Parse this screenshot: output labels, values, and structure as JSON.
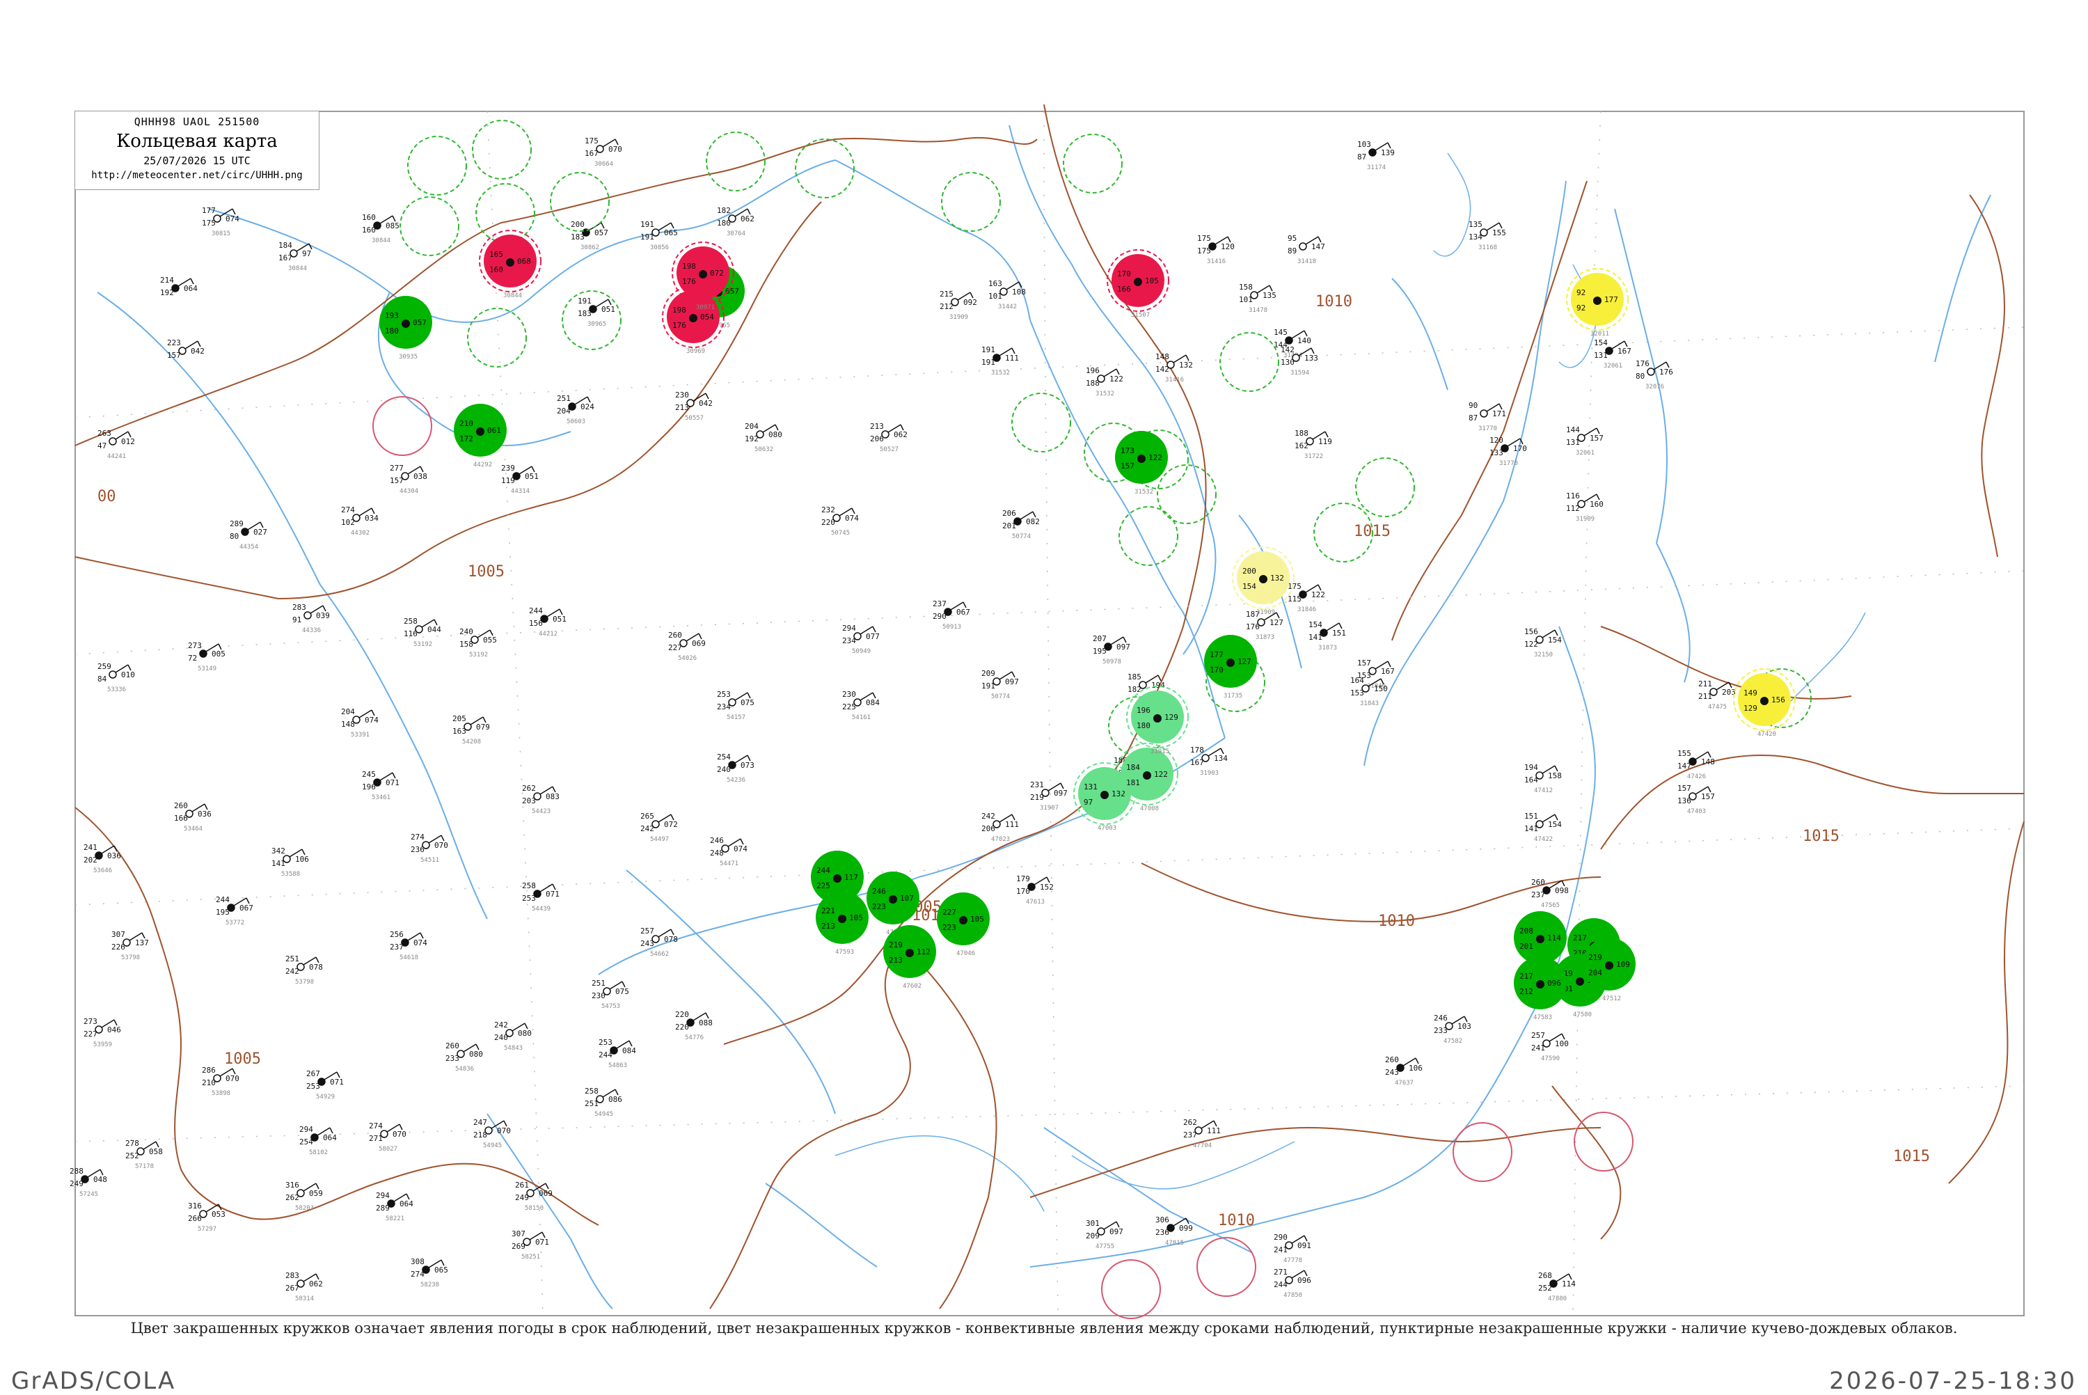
{
  "header": {
    "bulletin": "QHHH98  UAOL  251500",
    "title": "Кольцевая карта",
    "datetime": "25/07/2026 15 UTC",
    "url": "http://meteocenter.net/circ/UHHH.png"
  },
  "caption": "Цвет закрашенных кружков означает явления погоды в срок наблюдений, цвет незакрашенных кружков - конвективные явления между сроками наблюдений, пунктирные незакрашенные кружки - наличие кучево-дождевых облаков.",
  "footer": {
    "left": "GrADS/COLA",
    "right": "2026-07-25-18:30"
  },
  "colors": {
    "frame": "#999999",
    "isobar": "#a0522d",
    "river": "#6aaee8",
    "cb_ring": "#2eb82e",
    "rain": "#00b400",
    "shower": "#66e08a",
    "thunder": "#e8194a",
    "fog": "#f7ef3a",
    "fog_light": "#f7f39a"
  },
  "isobars": [
    {
      "label": "1005"
    },
    {
      "label": "1010"
    },
    {
      "label": "1015"
    }
  ],
  "stations": [
    {
      "t": "214",
      "p": "064",
      "td": "192",
      "id": ""
    },
    {
      "t": "177",
      "p": "074",
      "td": "175",
      "id": "30815"
    },
    {
      "t": "184",
      "p": "97",
      "td": "167",
      "id": "30844"
    },
    {
      "t": "160",
      "p": "085",
      "td": "160",
      "id": "30844"
    },
    {
      "t": "223",
      "p": "042",
      "td": "157",
      "id": ""
    },
    {
      "t": "263",
      "p": "012",
      "td": "47",
      "id": "44241"
    },
    {
      "t": "289",
      "p": "027",
      "td": "80",
      "id": "44354"
    },
    {
      "t": "274",
      "p": "034",
      "td": "102",
      "id": "44302"
    },
    {
      "t": "277",
      "p": "038",
      "td": "157",
      "id": "44304"
    },
    {
      "t": "239",
      "p": "051",
      "td": "119",
      "id": "44314"
    },
    {
      "t": "283",
      "p": "039",
      "td": "91",
      "id": "44336"
    },
    {
      "t": "259",
      "p": "010",
      "td": "84",
      "id": "53336"
    },
    {
      "t": "273",
      "p": "005",
      "td": "72",
      "id": "53149"
    },
    {
      "t": "258",
      "p": "044",
      "td": "116",
      "id": "53192"
    },
    {
      "t": "240",
      "p": "055",
      "td": "158",
      "id": "53192"
    },
    {
      "t": "244",
      "p": "051",
      "td": "156",
      "id": "44212"
    },
    {
      "t": "260",
      "p": "069",
      "td": "227",
      "id": "54026"
    },
    {
      "t": "294",
      "p": "077",
      "td": "234",
      "id": "50949"
    },
    {
      "t": "237",
      "p": "067",
      "td": "290",
      "id": "50913"
    },
    {
      "t": "232",
      "p": "074",
      "td": "220",
      "id": "50745"
    },
    {
      "t": "230",
      "p": "042",
      "td": "213",
      "id": "50557"
    },
    {
      "t": "251",
      "p": "024",
      "td": "204",
      "id": "50603"
    },
    {
      "t": "204",
      "p": "080",
      "td": "192",
      "id": "50632"
    },
    {
      "t": "213",
      "p": "062",
      "td": "206",
      "id": "50527"
    },
    {
      "t": "206",
      "p": "082",
      "td": "201",
      "id": "50774"
    },
    {
      "t": "230",
      "p": "084",
      "td": "225",
      "id": "54161"
    },
    {
      "t": "253",
      "p": "075",
      "td": "234",
      "id": "54157"
    },
    {
      "t": "254",
      "p": "073",
      "td": "240",
      "id": "54236"
    },
    {
      "t": "204",
      "p": "074",
      "td": "148",
      "id": "53391"
    },
    {
      "t": "205",
      "p": "079",
      "td": "163",
      "id": "54208"
    },
    {
      "t": "245",
      "p": "071",
      "td": "196",
      "id": "53461"
    },
    {
      "t": "262",
      "p": "083",
      "td": "203",
      "id": "54423"
    },
    {
      "t": "260",
      "p": "036",
      "td": "166",
      "id": "53464"
    },
    {
      "t": "241",
      "p": "036",
      "td": "202",
      "id": "53646"
    },
    {
      "t": "342",
      "p": "106",
      "td": "141",
      "id": "53588"
    },
    {
      "t": "274",
      "p": "070",
      "td": "236",
      "id": "54511"
    },
    {
      "t": "258",
      "p": "071",
      "td": "253",
      "id": "54439"
    },
    {
      "t": "265",
      "p": "072",
      "td": "242",
      "id": "54497"
    },
    {
      "t": "246",
      "p": "074",
      "td": "248",
      "id": "54471"
    },
    {
      "t": "244",
      "p": "067",
      "td": "195",
      "id": "53772"
    },
    {
      "t": "307",
      "p": "137",
      "td": "226",
      "id": "53798"
    },
    {
      "t": "251",
      "p": "078",
      "td": "242",
      "id": "53798"
    },
    {
      "t": "256",
      "p": "074",
      "td": "237",
      "id": "54618"
    },
    {
      "t": "257",
      "p": "078",
      "td": "243",
      "id": "54662"
    },
    {
      "t": "251",
      "p": "075",
      "td": "230",
      "id": "54753"
    },
    {
      "t": "220",
      "p": "088",
      "td": "220",
      "id": "54776"
    },
    {
      "t": "273",
      "p": "046",
      "td": "227",
      "id": "53959"
    },
    {
      "t": "286",
      "p": "070",
      "td": "210",
      "id": "53898"
    },
    {
      "t": "267",
      "p": "071",
      "td": "253",
      "id": "54929"
    },
    {
      "t": "260",
      "p": "080",
      "td": "233",
      "id": "54836"
    },
    {
      "t": "242",
      "p": "080",
      "td": "240",
      "id": "54843"
    },
    {
      "t": "253",
      "p": "084",
      "td": "244",
      "id": "54863"
    },
    {
      "t": "258",
      "p": "086",
      "td": "251",
      "id": "54945"
    },
    {
      "t": "247",
      "p": "070",
      "td": "218",
      "id": "54945"
    },
    {
      "t": "294",
      "p": "064",
      "td": "254",
      "id": "58102"
    },
    {
      "t": "274",
      "p": "070",
      "td": "271",
      "id": "58027"
    },
    {
      "t": "278",
      "p": "058",
      "td": "252",
      "id": "57178"
    },
    {
      "t": "288",
      "p": "048",
      "td": "249",
      "id": "57245"
    },
    {
      "t": "316",
      "p": "053",
      "td": "266",
      "id": "57297"
    },
    {
      "t": "316",
      "p": "059",
      "td": "262",
      "id": "58203"
    },
    {
      "t": "294",
      "p": "064",
      "td": "289",
      "id": "58221"
    },
    {
      "t": "261",
      "p": "069",
      "td": "249",
      "id": "58150"
    },
    {
      "t": "307",
      "p": "071",
      "td": "269",
      "id": "58251"
    },
    {
      "t": "308",
      "p": "065",
      "td": "274",
      "id": "58238"
    },
    {
      "t": "283",
      "p": "062",
      "td": "267",
      "id": "58314"
    },
    {
      "t": "175",
      "p": "070",
      "td": "167",
      "id": "30664"
    },
    {
      "t": "200",
      "p": "057",
      "td": "183",
      "id": "30862"
    },
    {
      "t": "191",
      "p": "065",
      "td": "191",
      "id": "30856"
    },
    {
      "t": "182",
      "p": "062",
      "td": "180",
      "id": "30764"
    },
    {
      "t": "191",
      "p": "051",
      "td": "183",
      "id": "30965"
    },
    {
      "t": "215",
      "p": "092",
      "td": "212",
      "id": "31909"
    },
    {
      "t": "163",
      "p": "108",
      "td": "101",
      "id": "31442"
    },
    {
      "t": "191",
      "p": "111",
      "td": "191",
      "id": "31532"
    },
    {
      "t": "196",
      "p": "122",
      "td": "188",
      "id": "31532"
    },
    {
      "t": "148",
      "p": "132",
      "td": "142",
      "id": "31416"
    },
    {
      "t": "175",
      "p": "120",
      "td": "175",
      "id": "31416"
    },
    {
      "t": "158",
      "p": "135",
      "td": "101",
      "id": "31478"
    },
    {
      "t": "95",
      "p": "147",
      "td": "89",
      "id": "31418"
    },
    {
      "t": "145",
      "p": "140",
      "td": "144",
      "id": "31484"
    },
    {
      "t": "142",
      "p": "133",
      "td": "130",
      "id": "31594"
    },
    {
      "t": "188",
      "p": "119",
      "td": "162",
      "id": "31722"
    },
    {
      "t": "103",
      "p": "139",
      "td": "87",
      "id": "31174"
    },
    {
      "t": "135",
      "p": "155",
      "td": "134",
      "id": "31168"
    },
    {
      "t": "90",
      "p": "171",
      "td": "87",
      "id": "31770"
    },
    {
      "t": "120",
      "p": "170",
      "td": "133",
      "id": "31770"
    },
    {
      "t": "116",
      "p": "160",
      "td": "112",
      "id": "31909"
    },
    {
      "t": "144",
      "p": "157",
      "td": "131",
      "id": "32061"
    },
    {
      "t": "154",
      "p": "167",
      "td": "131",
      "id": "32061"
    },
    {
      "t": "176",
      "p": "176",
      "td": "80",
      "id": "32076"
    },
    {
      "t": "156",
      "p": "154",
      "td": "122",
      "id": "32150"
    },
    {
      "t": "175",
      "p": "122",
      "td": "115",
      "id": "31846"
    },
    {
      "t": "157",
      "p": "167",
      "td": "153",
      "id": "31846"
    },
    {
      "t": "164",
      "p": "150",
      "td": "153",
      "id": "31843"
    },
    {
      "t": "154",
      "p": "151",
      "td": "141",
      "id": "31873"
    },
    {
      "t": "187",
      "p": "127",
      "td": "176",
      "id": "31873"
    },
    {
      "t": "209",
      "p": "097",
      "td": "191",
      "id": "50774"
    },
    {
      "t": "207",
      "p": "097",
      "td": "195",
      "id": "50978"
    },
    {
      "t": "185",
      "p": "194",
      "td": "182",
      "id": "31802"
    },
    {
      "t": "178",
      "p": "134",
      "td": "167",
      "id": "31903"
    },
    {
      "t": "188",
      "p": "97",
      "td": "188",
      "id": "31905"
    },
    {
      "t": "231",
      "p": "097",
      "td": "219",
      "id": "31907"
    },
    {
      "t": "242",
      "p": "111",
      "td": "206",
      "id": "47023"
    },
    {
      "t": "179",
      "p": "152",
      "td": "170",
      "id": "47613"
    },
    {
      "t": "194",
      "p": "158",
      "td": "164",
      "id": "47412"
    },
    {
      "t": "151",
      "p": "154",
      "td": "141",
      "id": "47422"
    },
    {
      "t": "155",
      "p": "148",
      "td": "147",
      "id": "47426"
    },
    {
      "t": "157",
      "p": "157",
      "td": "136",
      "id": "47403"
    },
    {
      "t": "211",
      "p": "203",
      "td": "211",
      "id": "47475"
    },
    {
      "t": "260",
      "p": "098",
      "td": "237",
      "id": "47565"
    },
    {
      "t": "246",
      "p": "103",
      "td": "233",
      "id": "47582"
    },
    {
      "t": "257",
      "p": "100",
      "td": "241",
      "id": "47590"
    },
    {
      "t": "260",
      "p": "106",
      "td": "243",
      "id": "47637"
    },
    {
      "t": "262",
      "p": "111",
      "td": "237",
      "id": "47704"
    },
    {
      "t": "301",
      "p": "097",
      "td": "209",
      "id": "47755"
    },
    {
      "t": "306",
      "p": "099",
      "td": "236",
      "id": "47815"
    },
    {
      "t": "290",
      "p": "091",
      "td": "241",
      "id": "47778"
    },
    {
      "t": "271",
      "p": "096",
      "td": "244",
      "id": "47850"
    },
    {
      "t": "268",
      "p": "114",
      "td": "252",
      "id": "47880"
    }
  ],
  "weather_circles": [
    {
      "kind": "rain",
      "t": "193",
      "p": "057",
      "td": "180",
      "id": "30935"
    },
    {
      "kind": "rain",
      "t": "210",
      "p": "061",
      "td": "172",
      "id": "44292"
    },
    {
      "kind": "rain",
      "t": "188",
      "p": "057",
      "td": "183",
      "id": "30965"
    },
    {
      "kind": "rain",
      "t": "173",
      "p": "122",
      "td": "157",
      "id": "31532"
    },
    {
      "kind": "rain",
      "t": "177",
      "p": "127",
      "td": "170",
      "id": "31735"
    },
    {
      "kind": "rain",
      "t": "244",
      "p": "117",
      "td": "225",
      "id": "47009"
    },
    {
      "kind": "rain",
      "t": "246",
      "p": "107",
      "td": "223",
      "id": "47018"
    },
    {
      "kind": "rain",
      "t": "227",
      "p": "105",
      "td": "223",
      "id": "47046"
    },
    {
      "kind": "rain",
      "t": "219",
      "p": "112",
      "td": "213",
      "id": "47602"
    },
    {
      "kind": "rain",
      "t": "221",
      "p": "105",
      "td": "213",
      "id": "47593"
    },
    {
      "kind": "rain",
      "t": "208",
      "p": "114",
      "td": "201",
      "id": "47520"
    },
    {
      "kind": "rain",
      "t": "217",
      "p": "104",
      "td": "210",
      "id": "47543"
    },
    {
      "kind": "rain",
      "t": "219",
      "p": "101",
      "td": "201",
      "id": "47580"
    },
    {
      "kind": "rain",
      "t": "217",
      "p": "096",
      "td": "212",
      "id": "47583"
    },
    {
      "kind": "rain",
      "t": "219",
      "p": "109",
      "td": "204",
      "id": "47512"
    },
    {
      "kind": "shower",
      "t": "131",
      "p": "132",
      "td": "97",
      "id": "47003"
    },
    {
      "kind": "shower",
      "t": "184",
      "p": "122",
      "td": "181",
      "id": "47008"
    },
    {
      "kind": "shower",
      "t": "196",
      "p": "129",
      "td": "180",
      "id": "31915"
    },
    {
      "kind": "thunder",
      "t": "165",
      "p": "068",
      "td": "160",
      "id": "30844"
    },
    {
      "kind": "thunder",
      "t": "198",
      "p": "054",
      "td": "176",
      "id": "30969"
    },
    {
      "kind": "thunder",
      "t": "198",
      "p": "072",
      "td": "176",
      "id": "30971"
    },
    {
      "kind": "thunder",
      "t": "170",
      "p": "105",
      "td": "166",
      "id": "31507"
    },
    {
      "kind": "fog",
      "t": "92",
      "p": "177",
      "td": "92",
      "id": "32011"
    },
    {
      "kind": "fog",
      "t": "149",
      "p": "156",
      "td": "129",
      "id": "47420"
    },
    {
      "kind": "fog_light",
      "t": "200",
      "p": "132",
      "td": "154",
      "id": "31909"
    }
  ]
}
